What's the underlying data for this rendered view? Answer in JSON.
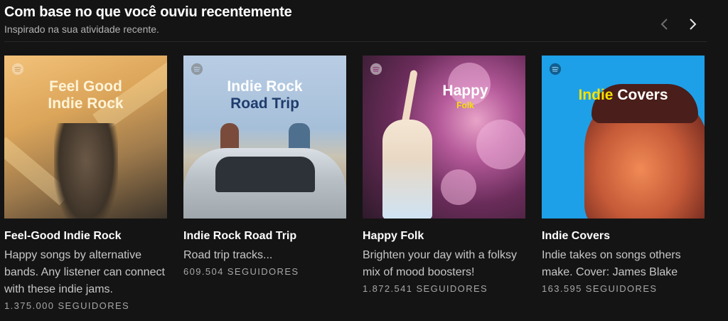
{
  "section": {
    "title": "Com base no que você ouviu recentemente",
    "subtitle": "Inspirado na sua atividade recente."
  },
  "nav": {
    "prev_icon": "chevron-left-icon",
    "next_icon": "chevron-right-icon"
  },
  "colors": {
    "background": "#141414",
    "text_primary": "#ffffff",
    "text_secondary": "#b3b3b3"
  },
  "cards": [
    {
      "name": "Feel-Good Indie Rock",
      "description": "Happy songs by alternative bands. Any listener can connect with these indie jams.",
      "followers": "1.375.000 SEGUIDORES",
      "art_line1": "Feel Good",
      "art_line2": "Indie Rock"
    },
    {
      "name": "Indie Rock Road Trip",
      "description": "Road trip tracks...",
      "followers": "609.504 SEGUIDORES",
      "art_line1": "Indie Rock",
      "art_line2": "Road Trip"
    },
    {
      "name": "Happy Folk",
      "description": "Brighten your day with a folksy mix of mood boosters!",
      "followers": "1.872.541 SEGUIDORES",
      "art_line1": "Happy",
      "art_line2": "Folk"
    },
    {
      "name": "Indie Covers",
      "description": "Indie takes on songs others make. Cover: James Blake",
      "followers": "163.595 SEGUIDORES",
      "art_line1": "Indie",
      "art_line2": "Covers"
    }
  ]
}
